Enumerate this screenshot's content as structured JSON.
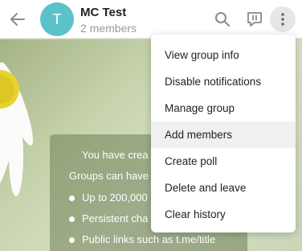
{
  "header": {
    "avatar_letter": "T",
    "avatar_color": "#5bc2c9",
    "title": "MC Test",
    "subtitle": "2 members",
    "icons": [
      "arrow-left-icon",
      "search-icon",
      "comments-icon",
      "more-vertical-icon"
    ]
  },
  "menu": {
    "items": [
      {
        "label": "View group info"
      },
      {
        "label": "Disable notifications"
      },
      {
        "label": "Manage group"
      },
      {
        "label": "Add members"
      },
      {
        "label": "Create poll"
      },
      {
        "label": "Delete and leave"
      },
      {
        "label": "Clear history"
      }
    ],
    "hovered_item": "Add members"
  },
  "info_card": {
    "title": "You have crea",
    "subtitle": "Groups can have",
    "bullets": [
      "Up to 200,000",
      "Persistent cha",
      "Public links such as t.me/title"
    ]
  }
}
